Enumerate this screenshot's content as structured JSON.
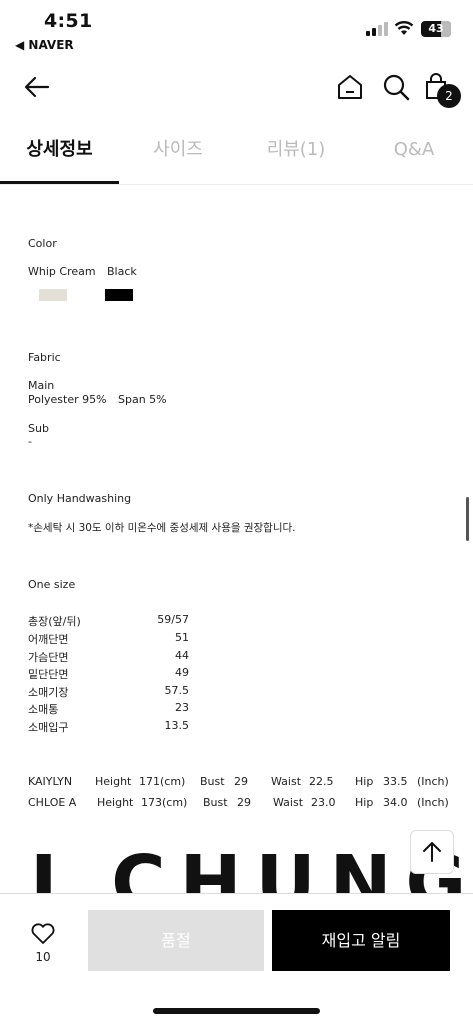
{
  "status_bar": {
    "time": "4:51",
    "back_app": "◀ NAVER",
    "battery": "43"
  },
  "header": {
    "cart_count": "2"
  },
  "tabs": [
    {
      "label": "상세정보",
      "active": true
    },
    {
      "label": "사이즈",
      "active": false
    },
    {
      "label": "리뷰(1)",
      "active": false
    },
    {
      "label": "Q&A",
      "active": false
    }
  ],
  "detail": {
    "color_heading": "Color",
    "colors": [
      {
        "name": "Whip Cream",
        "hex": "#e4e0d8"
      },
      {
        "name": "Black",
        "hex": "#000000"
      }
    ],
    "fabric_heading": "Fabric",
    "main_label": "Main",
    "main_value_1": "Polyester 95%",
    "main_value_2": "Span 5%",
    "sub_label": "Sub",
    "sub_value": "-",
    "care_heading": "Only Handwashing",
    "care_note": "*손세탁 시 30도 이하 미온수에 중성세제 사용을 권장합니다.",
    "size_heading": "One size",
    "sizes": [
      {
        "label": "총장(앞/뒤)",
        "value": "59/57"
      },
      {
        "label": "어깨단면",
        "value": "51"
      },
      {
        "label": "가슴단면",
        "value": "44"
      },
      {
        "label": "밑단단면",
        "value": "49"
      },
      {
        "label": "소매기장",
        "value": "57.5"
      },
      {
        "label": "소매통",
        "value": "23"
      },
      {
        "label": "소매입구",
        "value": "13.5"
      }
    ],
    "models": [
      {
        "name": "KAIYLYN",
        "height_label": "Height",
        "height": "171(cm)",
        "bust_label": "Bust",
        "bust": "29",
        "waist_label": "Waist",
        "waist": "22.5",
        "hip_label": "Hip",
        "hip": "33.5",
        "unit": "(Inch)"
      },
      {
        "name": "CHLOE A",
        "height_label": "Height",
        "height": "173(cm)",
        "bust_label": "Bust",
        "bust": "29",
        "waist_label": "Waist",
        "waist": "23.0",
        "hip_label": "Hip",
        "hip": "34.0",
        "unit": "(Inch)"
      }
    ],
    "brand_banner": "I CHUNG"
  },
  "bottom_bar": {
    "like_count": "10",
    "soldout_label": "품절",
    "restock_label": "재입고 알림"
  }
}
